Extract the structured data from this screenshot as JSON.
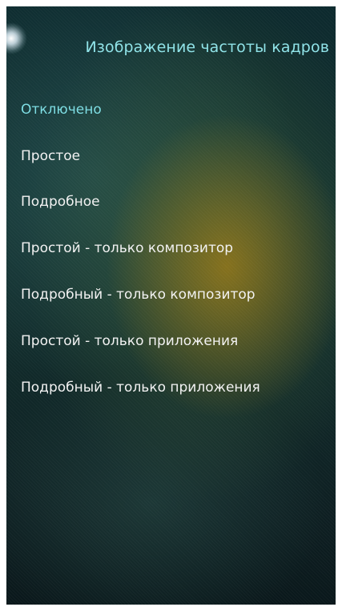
{
  "header": {
    "title": "Изображение частоты кадров"
  },
  "options": [
    {
      "label": "Отключено",
      "selected": true
    },
    {
      "label": "Простое",
      "selected": false
    },
    {
      "label": "Подробное",
      "selected": false
    },
    {
      "label": "Простой - только композитор",
      "selected": false
    },
    {
      "label": "Подробный - только композитор",
      "selected": false
    },
    {
      "label": "Простой - только приложения",
      "selected": false
    },
    {
      "label": "Подробный - только приложения",
      "selected": false
    }
  ],
  "colors": {
    "accent": "#7ddde3",
    "title": "#8fe3e8",
    "text": "#f2f2f2",
    "background": "#112a2a"
  }
}
